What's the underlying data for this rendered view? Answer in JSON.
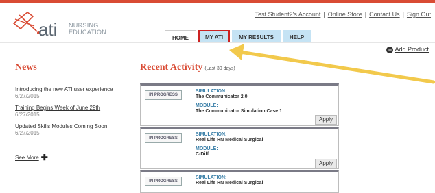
{
  "header": {
    "logo": {
      "brand": "ati",
      "line1": "NURSING",
      "line2": "EDUCATION"
    },
    "links": [
      "Test Student2's Account",
      "Online Store",
      "Contact Us",
      "Sign Out"
    ],
    "tabs": [
      "HOME",
      "MY ATI",
      "MY RESULTS",
      "HELP"
    ]
  },
  "sidebar": {
    "add_product": "Add Product"
  },
  "news": {
    "title": "News",
    "items": [
      {
        "title": "Introducing the new ATI user experience",
        "date": "6/27/2015"
      },
      {
        "title": "Training Begins Week of June 29th",
        "date": "6/27/2015"
      },
      {
        "title": "Updated Skills Modules Coming Soon",
        "date": "6/27/2015"
      }
    ],
    "see_more": "See More"
  },
  "recent": {
    "title": "Recent Activity",
    "subtitle": "(Last 30 days)",
    "cards": [
      {
        "status": "IN PROGRESS",
        "sim_label": "SIMULATION:",
        "sim_value": "The Communicator 2.0",
        "mod_label": "MODULE:",
        "mod_value": "The Communicator Simulation Case 1",
        "button": "Apply"
      },
      {
        "status": "IN PROGRESS",
        "sim_label": "SIMULATION:",
        "sim_value": "Real Life RN Medical Surgical",
        "mod_label": "MODULE:",
        "mod_value": "C-Diff",
        "button": "Apply"
      },
      {
        "status": "IN PROGRESS",
        "sim_label": "SIMULATION:",
        "sim_value": "Real Life RN Medical Surgical"
      }
    ]
  },
  "colors": {
    "accent": "#d94b34",
    "tab_bg": "#c5e3f4",
    "highlight": "#cc2222",
    "arrow": "#f2c94c"
  }
}
